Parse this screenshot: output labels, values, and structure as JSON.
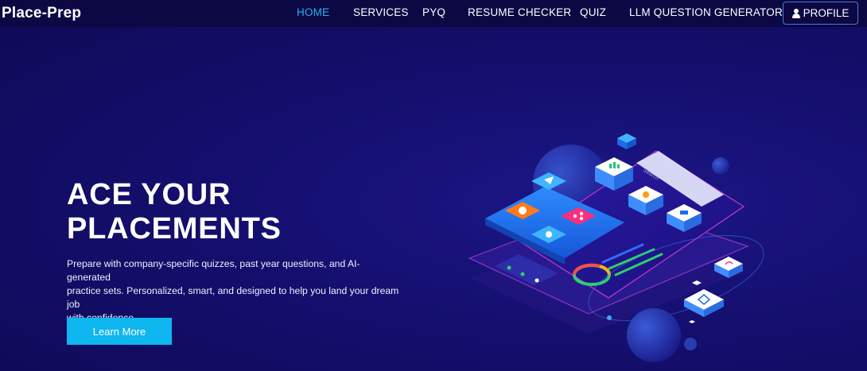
{
  "brand": "Place-Prep",
  "nav": {
    "items": [
      {
        "label": "HOME",
        "active": true
      },
      {
        "label": "SERVICES",
        "active": false
      },
      {
        "label": "PYQ",
        "active": false
      },
      {
        "label": "RESUME CHECKER",
        "active": false
      },
      {
        "label": "QUIZ",
        "active": false
      },
      {
        "label": "LLM QUESTION GENERATOR",
        "active": false
      }
    ],
    "profile_label": "PROFILE",
    "profile_icon": "user-icon"
  },
  "hero": {
    "title_line1": "ACE YOUR",
    "title_line2": "PLACEMENTS",
    "description_line1": "Prepare with company-specific quizzes, past year questions, and AI-generated",
    "description_line2": "practice sets. Personalized, smart, and designed to help you land your dream job",
    "description_line3": "with confidence.",
    "cta_label": "Learn More"
  },
  "illustration": {
    "search_placeholder": "Search"
  },
  "colors": {
    "background": "#140f6e",
    "navbar": "#0c0843",
    "active_link": "#25b3ef",
    "cta": "#0fb6f0"
  }
}
